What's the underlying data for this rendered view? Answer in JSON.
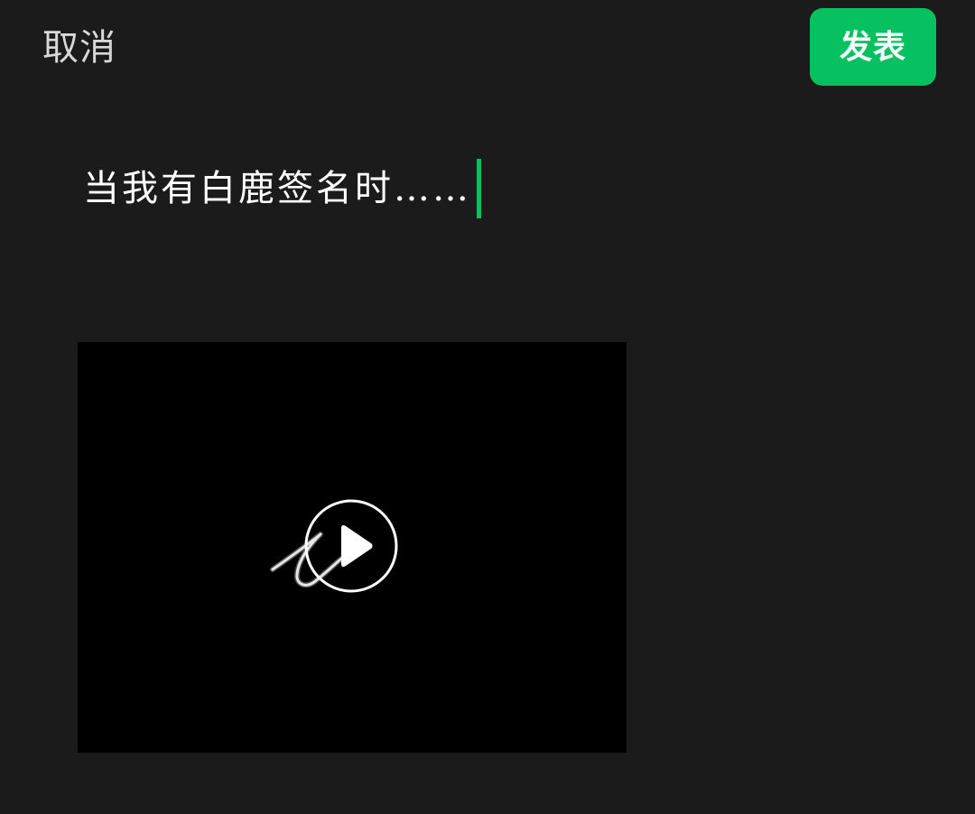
{
  "header": {
    "cancel_label": "取消",
    "publish_label": "发表"
  },
  "composer": {
    "text": "当我有白鹿签名时……"
  },
  "video": {
    "play_icon": "play-icon",
    "thumbnail": "handwritten-signature-stroke"
  },
  "colors": {
    "background": "#1b1b1b",
    "accent": "#07c160",
    "video_background": "#000000"
  }
}
